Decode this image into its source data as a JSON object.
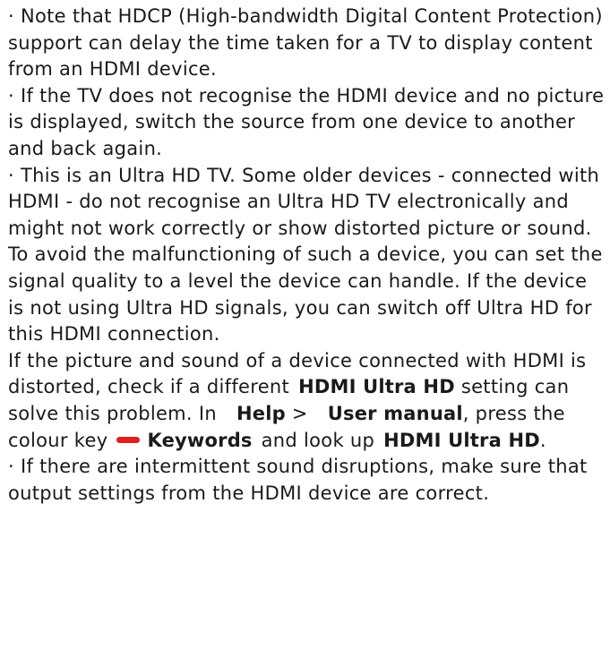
{
  "bullets": {
    "hdcp": "· Note that HDCP (High-bandwidth Digital Content Protection) support can delay the time taken for a TV to display content from an HDMI device.",
    "not_recognised": "· If the TV does not recognise the HDMI device and no picture is displayed, switch the source from one device to another and back again.",
    "ultra_hd": "· This is an Ultra HD TV. Some older devices - connected with HDMI - do not recognise an Ultra HD TV electronically and might not work correctly or show distorted picture or sound. To avoid the malfunctioning of such a device, you can set the signal quality to a level the device can handle. If the device is not using Ultra HD signals, you can switch off Ultra HD for this HDMI connection."
  },
  "distorted": {
    "text_1": "If the picture and sound of a device connected with HDMI is distorted, check if a different",
    "setting_name": "HDMI Ultra HD",
    "text_2": "setting can solve this problem. In",
    "help_label": "Help",
    "arrow": ">",
    "user_manual_label": "User manual",
    "text_3": ", press the colour key",
    "keywords_label": "Keywords",
    "text_4": "and look up",
    "lookup_term": "HDMI Ultra HD",
    "end": "."
  },
  "bullets_2": {
    "sound_disruptions": "· If there are intermittent sound disruptions, make sure that output settings from the HDMI device are correct."
  },
  "colors": {
    "color_key_red": "#e0201b",
    "text": "#1a1a1a",
    "background": "#ffffff"
  },
  "icons": {
    "color_key": "red-color-key-icon"
  }
}
